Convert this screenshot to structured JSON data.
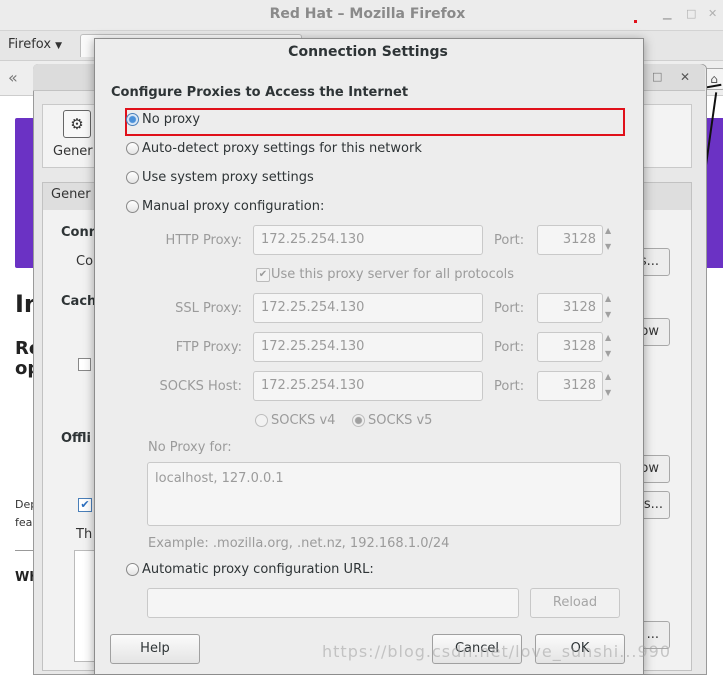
{
  "firefox": {
    "window_title": "Red Hat – Mozilla Firefox",
    "menu_label": "Firefox",
    "page_fragments": {
      "heading_in": "In",
      "heading_re": "Re",
      "heading_op": "op",
      "note_dep": "Dep",
      "note_fea": "fea",
      "footer_wh": "Wh"
    }
  },
  "preferences": {
    "toolbar_item": "Gener",
    "tab_label": "Gener",
    "section_conn": "Conn",
    "conn_text": "Co",
    "section_cache": "Cach",
    "section_offline": "Offli",
    "text_th": "Th",
    "btn_settings": "s...",
    "btn_now": "ow",
    "btn_now2": "ow",
    "btn_dots": "s...",
    "btn_dots2": "..."
  },
  "dialog": {
    "title": "Connection Settings",
    "heading": "Configure Proxies to Access the Internet",
    "options": {
      "no_proxy": "No proxy",
      "auto_detect": "Auto-detect proxy settings for this network",
      "system": "Use system proxy settings",
      "manual": "Manual proxy configuration:",
      "auto_url": "Automatic proxy configuration URL:"
    },
    "selected": "no_proxy",
    "manual": {
      "http_label": "HTTP Proxy:",
      "http_value": "172.25.254.130",
      "http_port": "3128",
      "use_all_label": "Use this proxy server for all protocols",
      "use_all_checked": true,
      "ssl_label": "SSL Proxy:",
      "ssl_value": "172.25.254.130",
      "ssl_port": "3128",
      "ftp_label": "FTP Proxy:",
      "ftp_value": "172.25.254.130",
      "ftp_port": "3128",
      "socks_label": "SOCKS Host:",
      "socks_value": "172.25.254.130",
      "socks_port": "3128",
      "port_label": "Port:",
      "socks_v4": "SOCKS v4",
      "socks_v5": "SOCKS v5",
      "socks_selected": "v5"
    },
    "no_proxy_for_label": "No Proxy for:",
    "no_proxy_for_value": "localhost, 127.0.0.1",
    "example": "Example: .mozilla.org, .net.nz, 192.168.1.0/24",
    "auto_url_value": "",
    "buttons": {
      "reload": "Reload",
      "help": "Help",
      "cancel": "Cancel",
      "ok": "OK"
    }
  },
  "watermark": "https://blog.csdn.net/love_sunshi...990",
  "colors": {
    "focus_outline": "#e0101a",
    "radio_selected": "#4a90d9",
    "firefox_purple": "#6b32c4"
  }
}
